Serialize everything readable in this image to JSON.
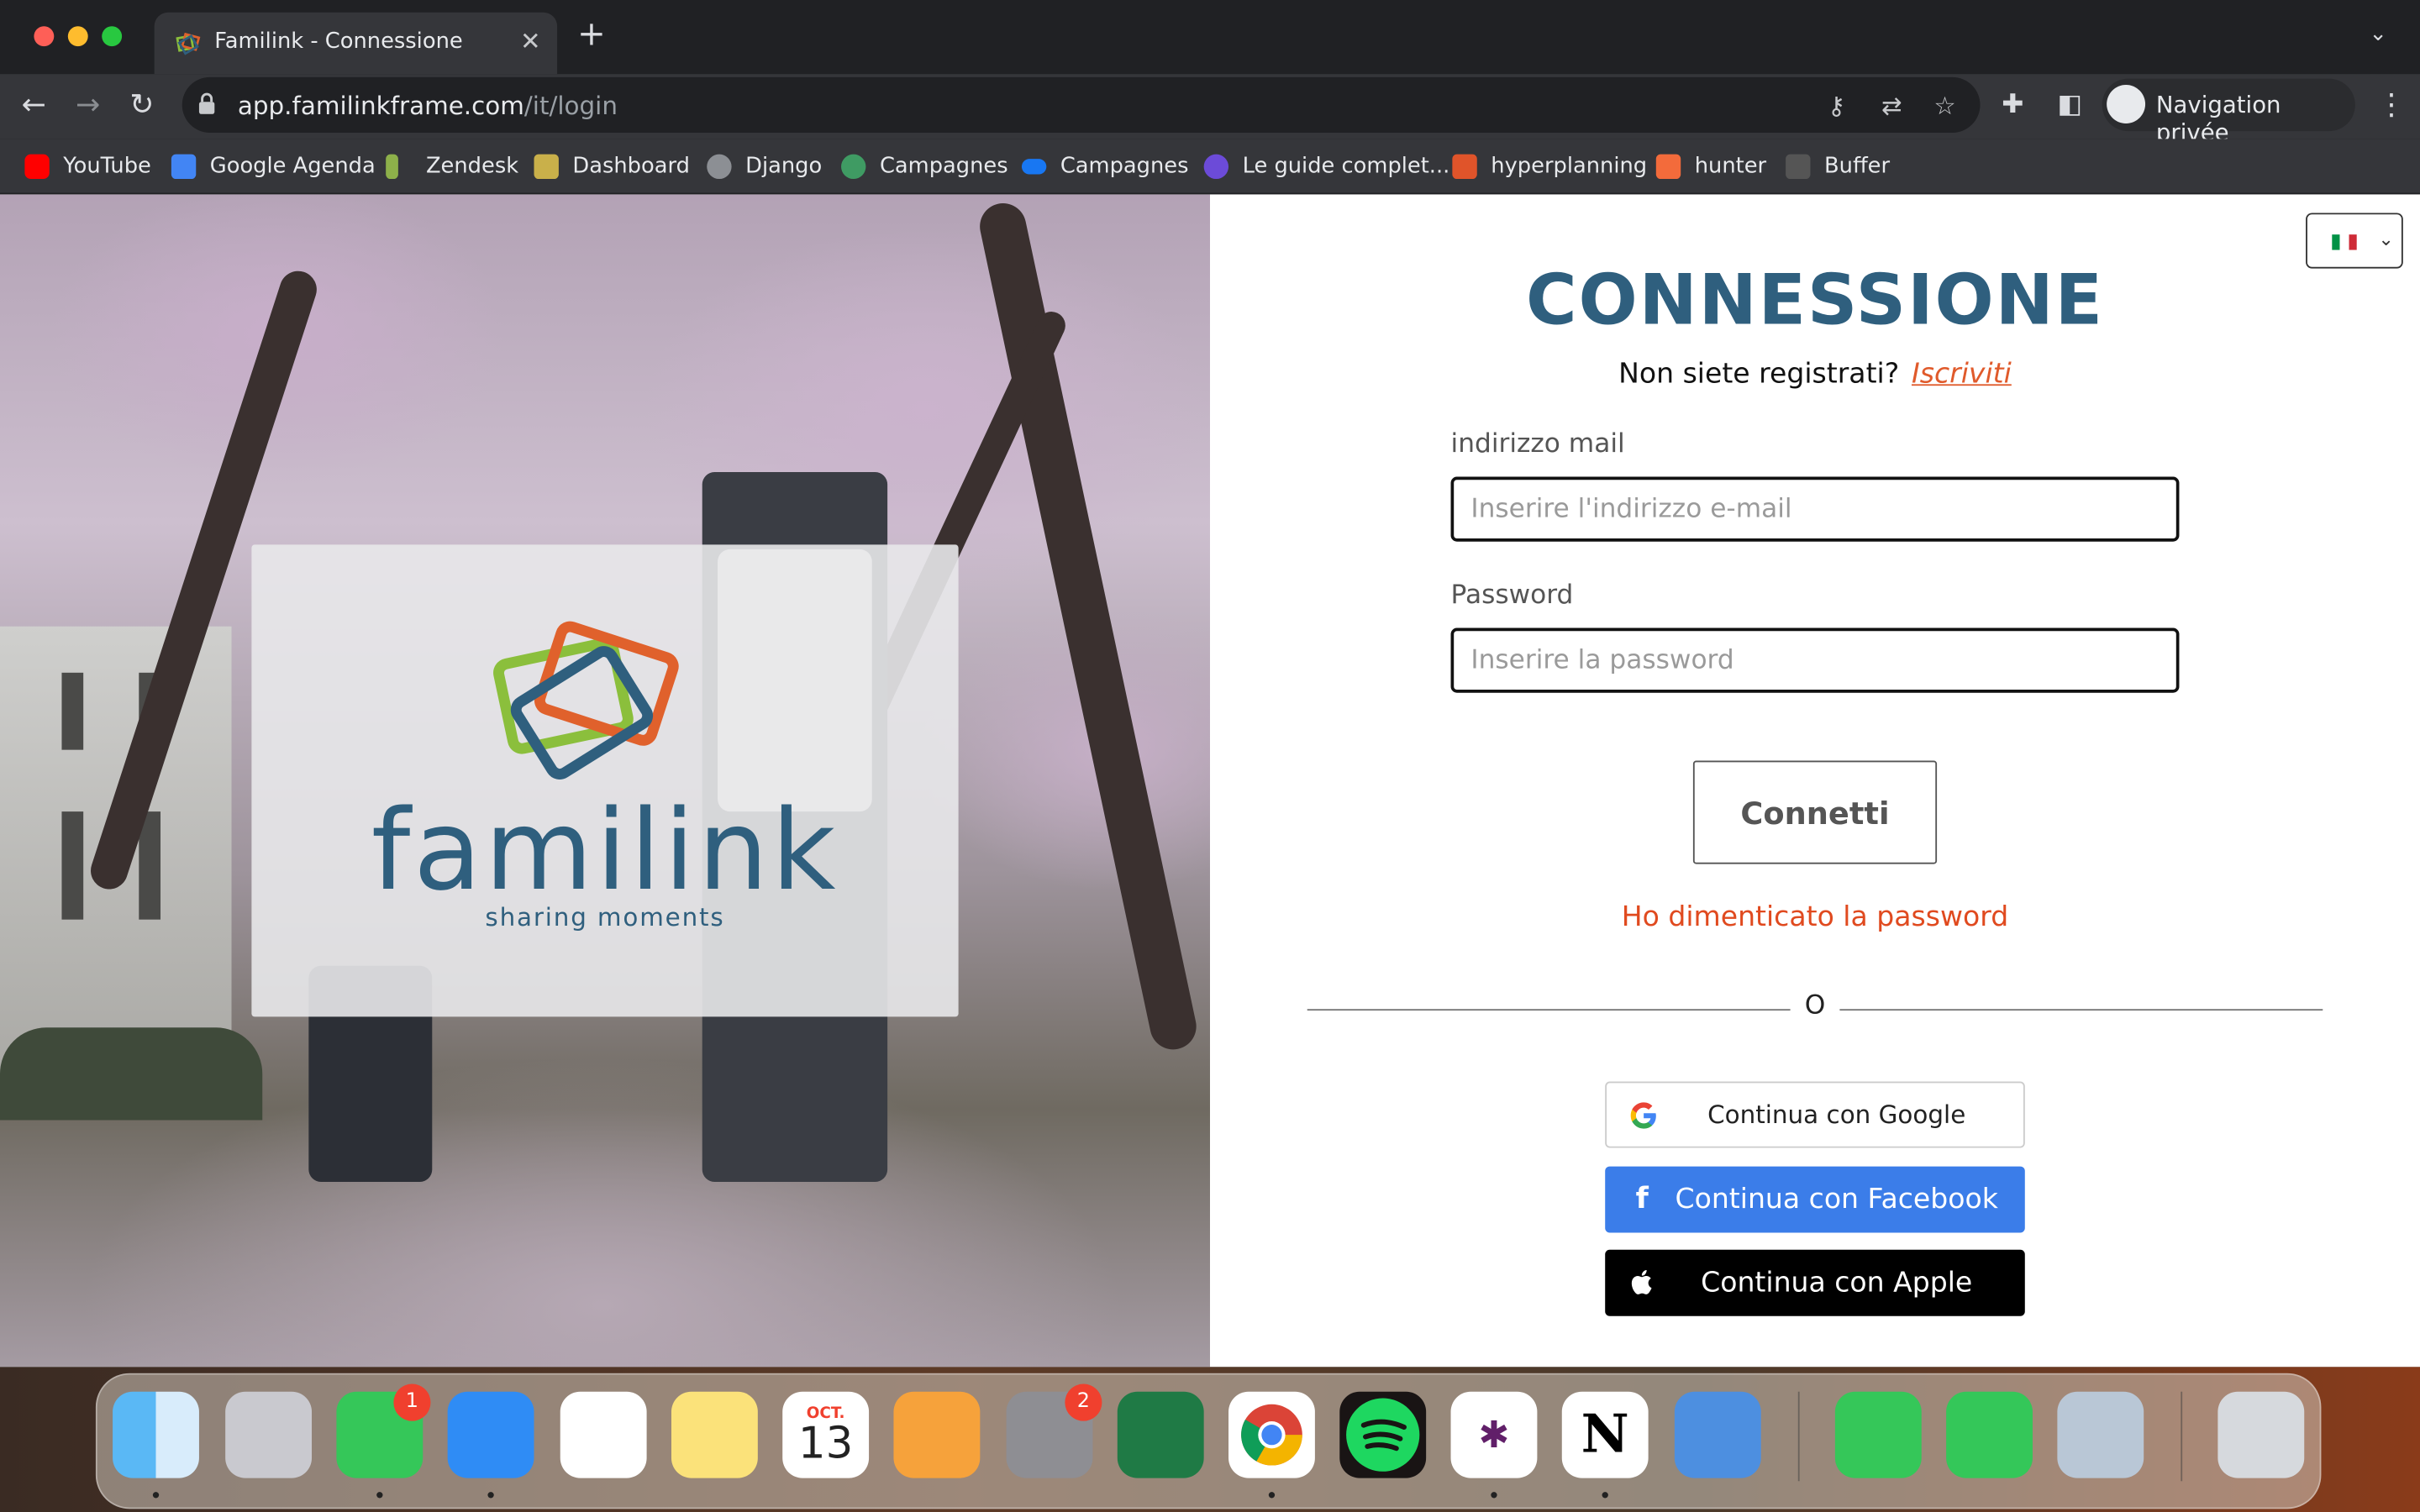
{
  "browser": {
    "tab_title": "Familink - Connessione",
    "url_host": "app.familinkframe.com",
    "url_path": "/it/login",
    "profile_label": "Navigation privée",
    "bookmarks": [
      "YouTube",
      "Google Agenda",
      "Zendesk",
      "Dashboard",
      "Django",
      "Campagnes",
      "Campagnes",
      "Le guide complet...",
      "hyperplanning",
      "hunter",
      "Buffer"
    ]
  },
  "hero": {
    "logo_word": "familink",
    "logo_tagline": "sharing moments"
  },
  "login": {
    "title": "CONNESSIONE",
    "register_prompt": "Non siete registrati?",
    "register_link": "Iscriviti",
    "email_label": "indirizzo mail",
    "email_placeholder": "Inserire l'indirizzo e-mail",
    "password_label": "Password",
    "password_placeholder": "Inserire la password",
    "submit_label": "Connetti",
    "forgot_label": "Ho dimenticato la password",
    "separator": "O",
    "google_label": "Continua con Google",
    "facebook_label": "Continua con Facebook",
    "apple_label": "Continua con Apple"
  },
  "dock": {
    "calendar_month": "OCT.",
    "calendar_day": "13",
    "messages_badge": "1",
    "settings_badge": "2"
  },
  "colors": {
    "brand": "#2f5f7e",
    "accent": "#e05a2b",
    "facebook": "#3b7de9"
  }
}
